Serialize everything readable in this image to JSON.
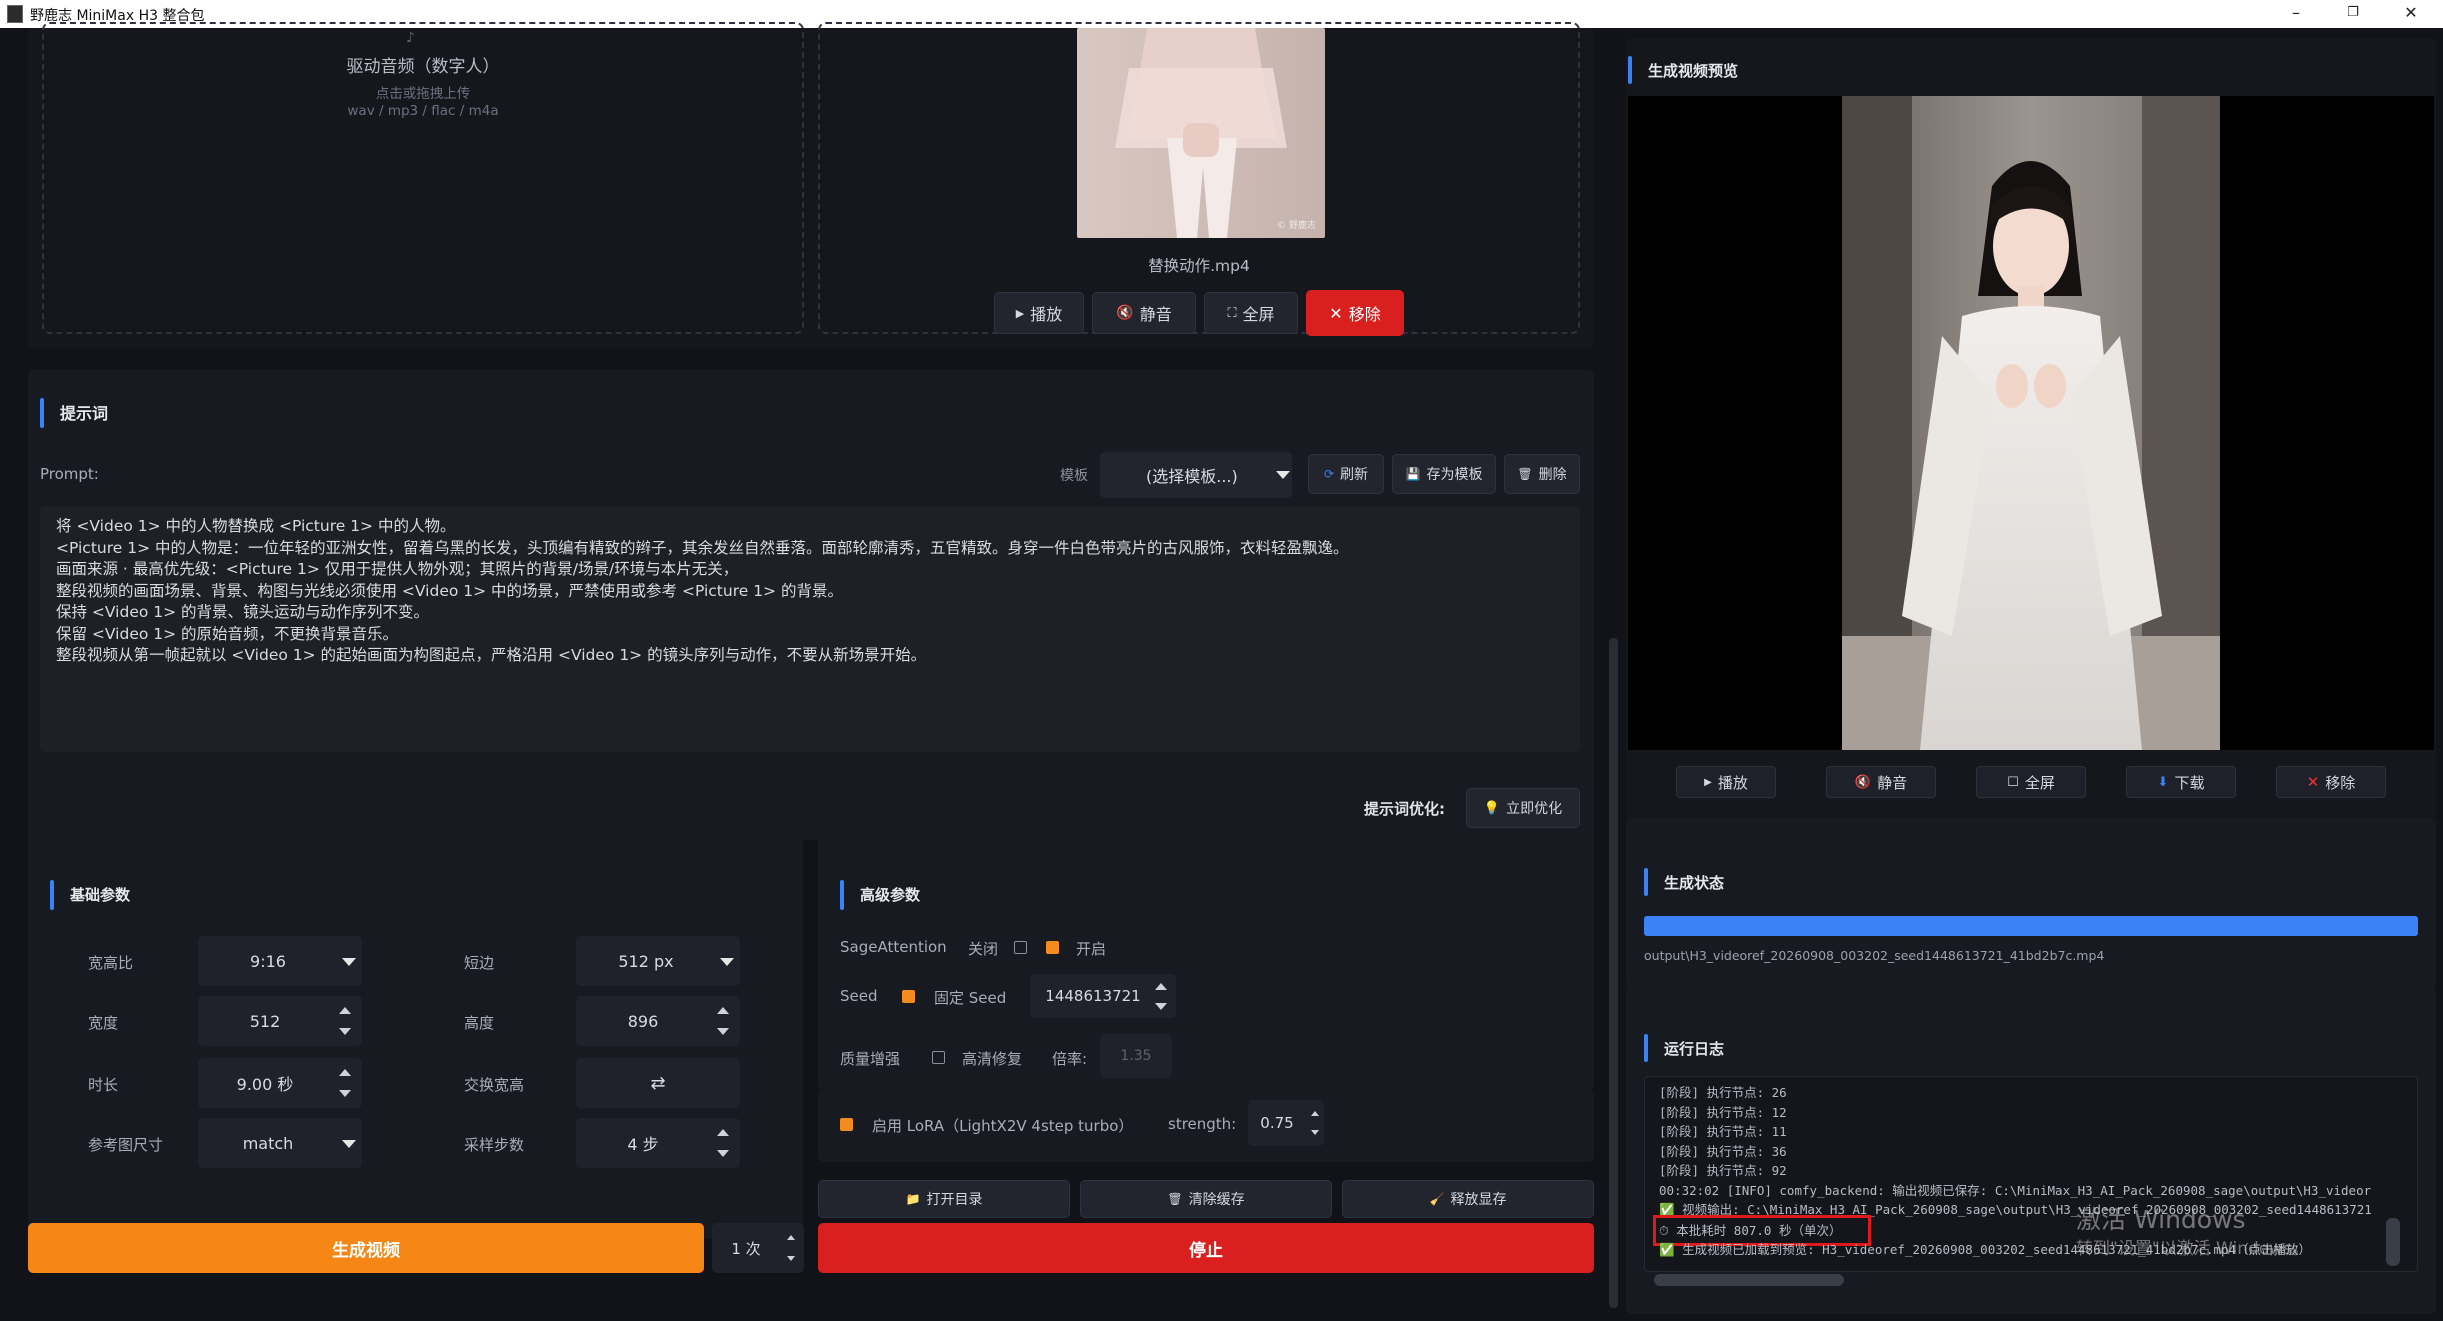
{
  "window": {
    "title": "野鹿志 MiniMax H3 整合包",
    "minimize": "–",
    "restore": "❐",
    "close": "✕"
  },
  "upload": {
    "title": "驱动音频（数字人）",
    "hint": "点击或拖拽上传",
    "formats": "wav / mp3 / flac / m4a"
  },
  "motion_video": {
    "filename": "替换动作.mp4",
    "watermark": "© 野鹿志",
    "play": "播放",
    "mute": "静音",
    "fullscreen": "全屏",
    "remove": "移除"
  },
  "prompt": {
    "section_title": "提示词",
    "label": "Prompt:",
    "template_label": "模板",
    "template_value": "(选择模板...)",
    "refresh": "刷新",
    "save_template": "存为模板",
    "delete": "删除",
    "lines": [
      "将 <Video 1> 中的人物替换成 <Picture 1> 中的人物。",
      "<Picture 1> 中的人物是：一位年轻的亚洲女性，留着乌黑的长发，头顶编有精致的辫子，其余发丝自然垂落。面部轮廓清秀，五官精致。身穿一件白色带亮片的古风服饰，衣料轻盈飘逸。",
      "画面来源 · 最高优先级：<Picture 1> 仅用于提供人物外观；其照片的背景/场景/环境与本片无关，",
      "整段视频的画面场景、背景、构图与光线必须使用 <Video 1> 中的场景，严禁使用或参考 <Picture 1> 的背景。",
      "保持 <Video 1> 的背景、镜头运动与动作序列不变。",
      "保留 <Video 1> 的原始音频，不更换背景音乐。",
      "整段视频从第一帧起就以 <Video 1> 的起始画面为构图起点，严格沿用 <Video 1> 的镜头序列与动作，不要从新场景开始。"
    ],
    "optimize_label": "提示词优化:",
    "optimize_button": "立即优化"
  },
  "basic": {
    "section_title": "基础参数",
    "aspect_label": "宽高比",
    "aspect_value": "9:16",
    "short_label": "短边",
    "short_value": "512 px",
    "width_label": "宽度",
    "width_value": "512",
    "height_label": "高度",
    "height_value": "896",
    "duration_label": "时长",
    "duration_value": "9.00 秒",
    "swap_label": "交换宽高",
    "swap_icon": "⇄",
    "ref_label": "参考图尺寸",
    "ref_value": "match",
    "steps_label": "采样步数",
    "steps_value": "4 步"
  },
  "advanced": {
    "section_title": "高级参数",
    "sage_label": "SageAttention",
    "sage_off": "关闭",
    "sage_on": "开启",
    "seed_label": "Seed",
    "seed_fixed": "固定 Seed",
    "seed_value": "1448613721",
    "quality_label": "质量增强",
    "hires_label": "高清修复",
    "ratio_label": "倍率:",
    "ratio_value": "1.35",
    "lora_label": "启用 LoRA（LightX2V 4step turbo）",
    "strength_label": "strength:",
    "strength_value": "0.75"
  },
  "actions": {
    "open_dir": "打开目录",
    "clear_cache": "清除缓存",
    "free_vram": "释放显存",
    "generate": "生成视频",
    "count": "1 次",
    "stop": "停止"
  },
  "preview": {
    "section_title": "生成视频预览",
    "play": "播放",
    "mute": "静音",
    "fullscreen": "全屏",
    "download": "下载",
    "remove": "移除"
  },
  "status": {
    "section_title": "生成状态",
    "progress": 1.0,
    "path": "output\\H3_videoref_20260908_003202_seed1448613721_41bd2b7c.mp4"
  },
  "log": {
    "section_title": "运行日志",
    "lines": [
      "[阶段] 执行节点: 26",
      "[阶段] 执行节点: 12",
      "[阶段] 执行节点: 11",
      "[阶段] 执行节点: 36",
      "[阶段] 执行节点: 92",
      "00:32:02 [INFO] comfy_backend: 输出视频已保存: C:\\MiniMax_H3_AI_Pack_260908_sage\\output\\H3_videor",
      "✅ 视频输出: C:\\MiniMax_H3_AI_Pack_260908_sage\\output\\H3_videoref_20260908_003202_seed1448613721",
      "⏱ 本批耗时 807.0 秒（单次）",
      "✅ 生成视频已加载到预览: H3_videoref_20260908_003202_seed1448613721_41bd2b7c.mp4（点击播放）"
    ]
  },
  "watermark": {
    "line1": "激活 Windows",
    "line2": "转到\"设置\"以激活 Windows。"
  },
  "colors": {
    "accent": "#3b82f6",
    "orange": "#f28c1e",
    "red": "#d9201f",
    "bg": "#121319"
  }
}
